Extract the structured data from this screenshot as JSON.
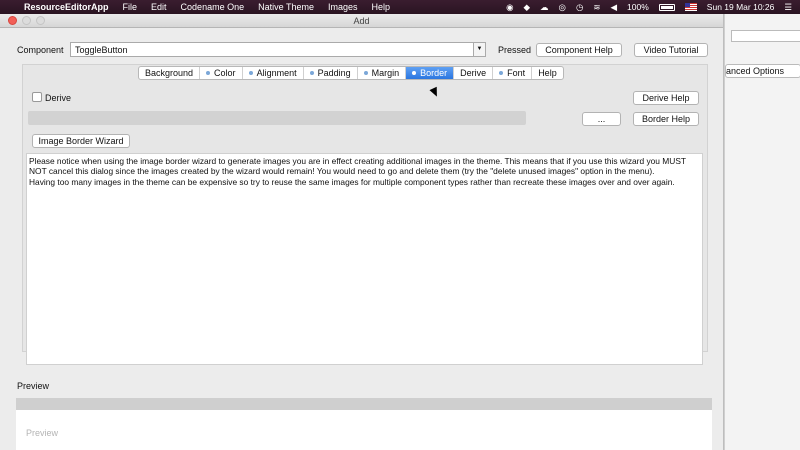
{
  "menubar": {
    "app_name": "ResourceEditorApp",
    "items": [
      "File",
      "Edit",
      "Codename One",
      "Native Theme",
      "Images",
      "Help"
    ],
    "battery": "100%",
    "datetime": "Sun 19 Mar  10:26"
  },
  "dialog": {
    "title": "Add",
    "component_label": "Component",
    "component_value": "ToggleButton",
    "pressed_label": "Pressed",
    "component_help": "Component Help",
    "video_tutorial": "Video Tutorial",
    "tabs": [
      {
        "label": "Background",
        "dot": false
      },
      {
        "label": "Color",
        "dot": true
      },
      {
        "label": "Alignment",
        "dot": true
      },
      {
        "label": "Padding",
        "dot": true
      },
      {
        "label": "Margin",
        "dot": true
      },
      {
        "label": "Border",
        "dot": true,
        "active": true
      },
      {
        "label": "Derive",
        "dot": false
      },
      {
        "label": "Font",
        "dot": true
      },
      {
        "label": "Help",
        "dot": false
      }
    ],
    "derive_label": "Derive",
    "derive_help": "Derive Help",
    "ellipsis": "...",
    "border_help": "Border Help",
    "image_border_wizard": "Image Border Wizard",
    "notice_line1": "Please notice when using the image border wizard to generate images you are in effect creating additional images in the theme. This means that if you use this wizard you MUST NOT cancel this dialog since the images created by the wizard would remain! You would need to go and delete them (try the \"delete unused images\" option in the menu).",
    "notice_line2": "Having too many images in the theme can be expensive so try to reuse the same images for multiple component types rather than recreate these images over and over again.",
    "preview_label": "Preview",
    "preview_text": "Preview"
  },
  "background_window": {
    "button_partial": "anced Options"
  }
}
